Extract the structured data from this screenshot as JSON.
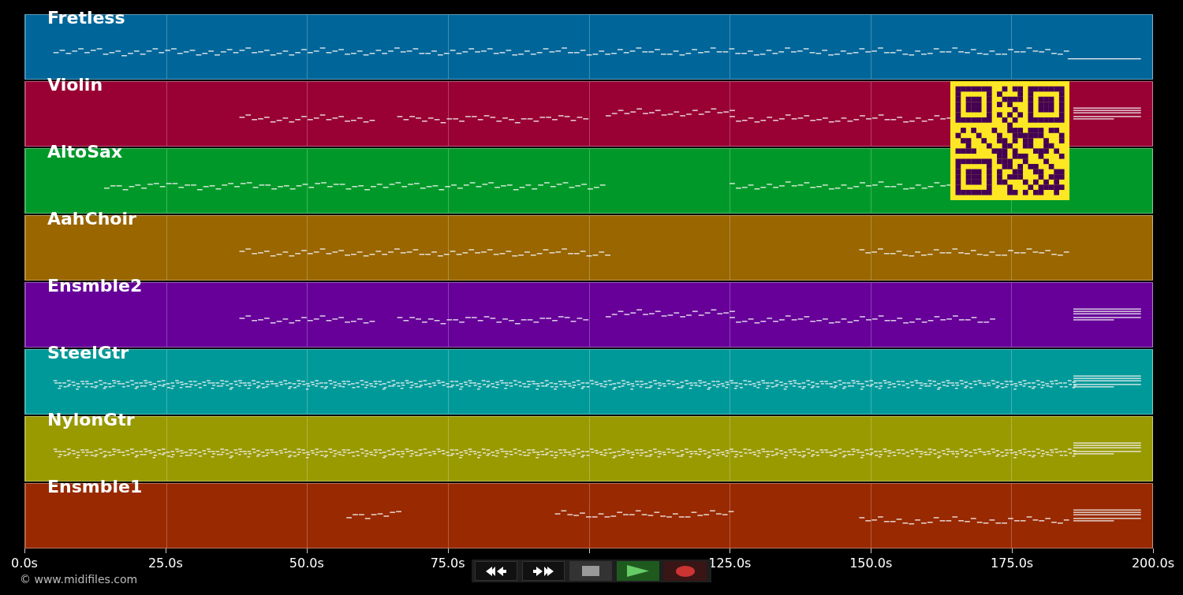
{
  "tracks": [
    {
      "name": "Fretless",
      "color": "#006699"
    },
    {
      "name": "Violin",
      "color": "#990033"
    },
    {
      "name": "AltoSax",
      "color": "#009929"
    },
    {
      "name": "AahChoir",
      "color": "#996600"
    },
    {
      "name": "Ensmble2",
      "color": "#660099"
    },
    {
      "name": "SteelGtr",
      "color": "#009999"
    },
    {
      "name": "NylonGtr",
      "color": "#999900"
    },
    {
      "name": "Ensmble1",
      "color": "#992900"
    }
  ],
  "timeline": {
    "ticks": [
      "0.0s",
      "25.0s",
      "50.0s",
      "75.0s",
      "125.0s",
      "150.0s",
      "175.0s",
      "200.0s"
    ]
  },
  "credit": "© www.midifiles.com",
  "transport": [
    {
      "kind": "rewind"
    },
    {
      "kind": "forward"
    },
    {
      "kind": "stop"
    },
    {
      "kind": "play"
    },
    {
      "kind": "record"
    }
  ]
}
